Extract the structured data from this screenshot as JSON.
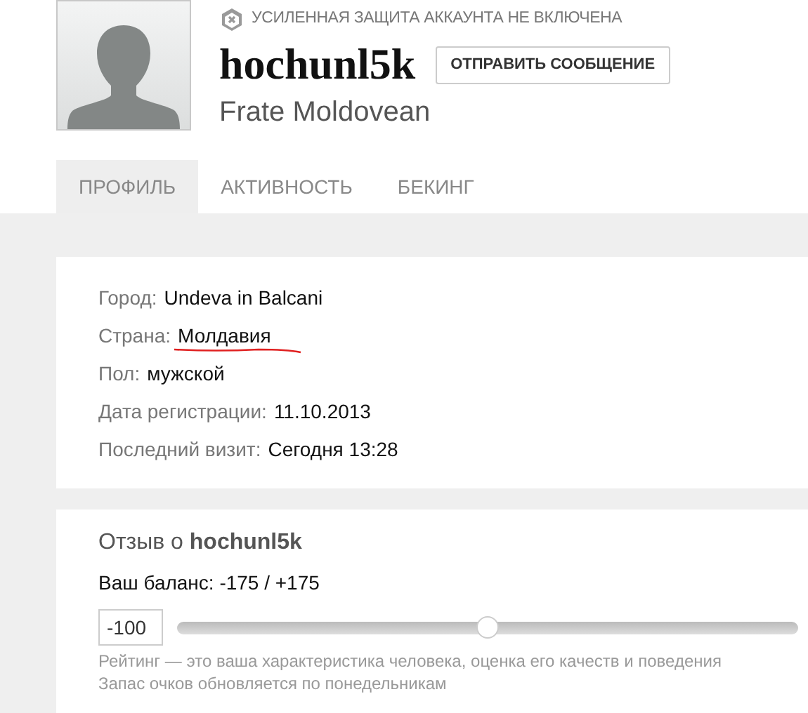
{
  "header": {
    "security_notice": "УСИЛЕННАЯ ЗАЩИТА АККАУНТА НЕ ВКЛЮЧЕНА",
    "username": "hochunl5k",
    "send_button": "ОТПРАВИТЬ СООБЩЕНИЕ",
    "display_name": "Frate Moldovean"
  },
  "tabs": [
    {
      "label": "ПРОФИЛЬ",
      "selected": true
    },
    {
      "label": "АКТИВНОСТЬ",
      "selected": false
    },
    {
      "label": "БЕКИНГ",
      "selected": false
    }
  ],
  "info": [
    {
      "label": "Город:",
      "value": "Undeva in Balcani",
      "underlined": false
    },
    {
      "label": "Страна:",
      "value": "Молдавия",
      "underlined": true
    },
    {
      "label": "Пол:",
      "value": "мужской",
      "underlined": false
    },
    {
      "label": "Дата регистрации:",
      "value": "11.10.2013",
      "underlined": false
    },
    {
      "label": "Последний визит:",
      "value": "Сегодня 13:28",
      "underlined": false
    }
  ],
  "review": {
    "title": "Отзыв о **hochunl5k**",
    "balance": "Ваш баланс: -175 / +175",
    "value": "-100",
    "level": 0.5,
    "hints": [
      "Рейтинг — это ваша характеристика человека, оценка его качеств и поведения",
      "Запас очков обновляется по понедельникам"
    ]
  }
}
